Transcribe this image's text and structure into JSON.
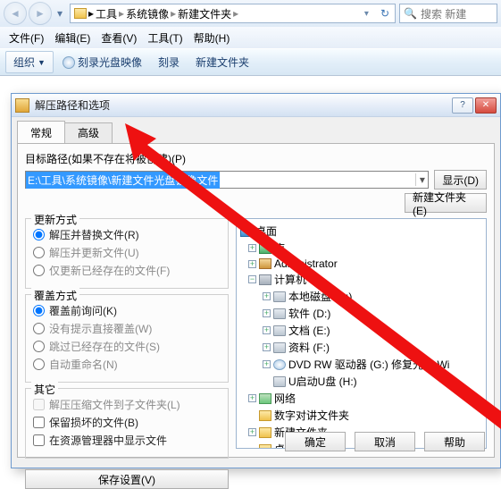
{
  "explorer": {
    "breadcrumbs": [
      "工具",
      "系统镜像",
      "新建文件夹"
    ],
    "refresh_label": "↻",
    "search_placeholder": "搜索 新建",
    "menus": {
      "file": "文件(F)",
      "edit": "编辑(E)",
      "view": "查看(V)",
      "tools": "工具(T)",
      "help": "帮助(H)"
    },
    "toolbar": {
      "organize": "组织",
      "burn_image": "刻录光盘映像",
      "burn": "刻录",
      "new_folder": "新建文件夹"
    }
  },
  "dialog": {
    "title": "解压路径和选项",
    "help_label": "?",
    "close_label": "✕",
    "tabs": {
      "general": "常规",
      "advanced": "高级"
    },
    "path_label": "目标路径(如果不存在将被创建)(P)",
    "path_value_prefix": "E:\\工具\\系统镜像\\新建文件",
    "path_value_selected": "光盘镜像文件",
    "display_btn": "显示(D)",
    "new_folder_btn": "新建文件夹(E)",
    "update_group": {
      "title": "更新方式",
      "opt_replace": "解压并替换文件(R)",
      "opt_update": "解压并更新文件(U)",
      "opt_fresh": "仅更新已经存在的文件(F)"
    },
    "overwrite_group": {
      "title": "覆盖方式",
      "opt_ask": "覆盖前询问(K)",
      "opt_force": "没有提示直接覆盖(W)",
      "opt_skip": "跳过已经存在的文件(S)",
      "opt_rename": "自动重命名(N)"
    },
    "misc_group": {
      "title": "其它",
      "opt_subfolder": "解压压缩文件到子文件夹(L)",
      "opt_keep_broken": "保留损坏的文件(B)",
      "opt_show_explorer": "在资源管理器中显示文件"
    },
    "save_settings": "保存设置(V)",
    "tree": {
      "desktop": "桌面",
      "libraries": "库",
      "admin": "Administrator",
      "computer": "计算机",
      "drive_c": "本地磁盘 (C:)",
      "drive_d": "软件 (D:)",
      "drive_e": "文档 (E:)",
      "drive_f": "资料 (F:)",
      "dvd": "DVD RW 驱动器 (G:) 修复光盘 Wi",
      "drive_h": "U启动U盘 (H:)",
      "network": "网络",
      "folder1": "数字对讲文件夹",
      "folder2": "新建文件夹",
      "folder3": "桌面文件"
    },
    "ok": "确定",
    "cancel": "取消",
    "help": "帮助"
  }
}
